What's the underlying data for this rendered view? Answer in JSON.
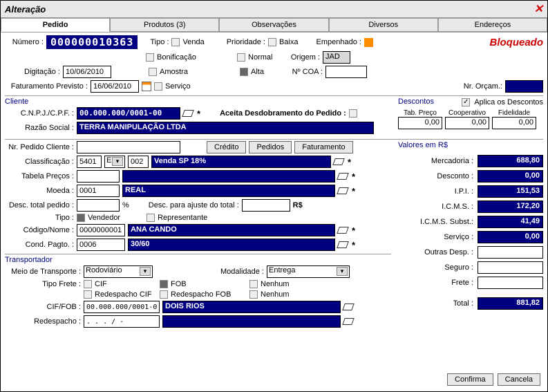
{
  "window": {
    "title": "Alteração",
    "bloqueado": "Bloqueado"
  },
  "tabs": {
    "pedido": "Pedido",
    "produtos": "Produtos (3)",
    "observacoes": "Observações",
    "diversos": "Diversos",
    "enderecos": "Endereços"
  },
  "header": {
    "numero_label": "Número :",
    "numero": "000000010363",
    "tipo_label": "Tipo :",
    "tipo": {
      "venda": "Venda",
      "bonificacao": "Bonificação",
      "amostra": "Amostra",
      "servico": "Serviço"
    },
    "prioridade_label": "Prioridade :",
    "prioridade": {
      "baixa": "Baixa",
      "normal": "Normal",
      "alta": "Alta"
    },
    "empenhado_label": "Empenhado :",
    "origem_label": "Origem :",
    "origem": "JAD",
    "ncoa_label": "Nº COA :",
    "ncoa": "",
    "digitacao_label": "Digitação :",
    "digitacao": "10/06/2010",
    "fatprev_label": "Faturamento Previsto :",
    "fatprev": "16/06/2010",
    "nrorcam_label": "Nr. Orçam.:"
  },
  "cliente": {
    "section": "Cliente",
    "cnpj_label": "C.N.P.J./C.P.F. :",
    "cnpj": "00.000.000/0001-00",
    "aceita_label": "Aceita Desdobramento do Pedido :",
    "razao_label": "Razão Social :",
    "razao": "TERRA   MANIPULAÇÃO LTDA"
  },
  "descontos": {
    "section": "Descontos",
    "aplica": "Aplica os Descontos",
    "tabpreco_h": "Tab. Preço",
    "coop_h": "Cooperativo",
    "fidel_h": "Fidelidade",
    "tabpreco": "0,00",
    "coop": "0,00",
    "fidel": "0,00"
  },
  "pedido": {
    "nrcliente_label": "Nr. Pedido Cliente :",
    "nrcliente": "",
    "btn_credito": "Crédito",
    "btn_pedidos": "Pedidos",
    "btn_fat": "Faturamento",
    "classific_label": "Classificação :",
    "classific1": "5401",
    "classific2": "E",
    "classific3": "002",
    "classific_desc": "Venda SP 18%",
    "tabprecos_label": "Tabela Preços :",
    "tabprecos": "",
    "tabprecos_desc": "",
    "moeda_label": "Moeda :",
    "moeda": "0001",
    "moeda_desc": "REAL",
    "desctotal_label": "Desc. total pedido :",
    "desctotal": "",
    "pct": "%",
    "descajuste_label": "Desc. para ajuste do total :",
    "descajuste": "",
    "rs": "R$",
    "tipo_label": "Tipo :",
    "vendedor": "Vendedor",
    "representante": "Representante",
    "codnome_label": "Código/Nome :",
    "cod": "0000000001",
    "nome": "ANA  CANDO",
    "condpagto_label": "Cond. Pagto. :",
    "condcod": "0006",
    "conddesc": "30/60"
  },
  "valores": {
    "section": "Valores em R$",
    "mercadoria_l": "Mercadoria :",
    "mercadoria": "688,80",
    "desconto_l": "Desconto :",
    "desconto": "0,00",
    "ipi_l": "I.P.I. :",
    "ipi": "151,53",
    "icms_l": "I.C.M.S. :",
    "icms": "172,20",
    "icmssubst_l": "I.C.M.S. Subst.:",
    "icmssubst": "41,49",
    "servico_l": "Serviço :",
    "servico": "0,00",
    "outras_l": "Outras Desp. :",
    "outras": "",
    "seguro_l": "Seguro :",
    "seguro": "",
    "frete_l": "Frete :",
    "frete": "",
    "total_l": "Total :",
    "total": "881,82"
  },
  "transp": {
    "section": "Transportador",
    "meio_label": "Meio de Transporte :",
    "meio": "Rodoviário",
    "modal_label": "Modalidade :",
    "modal": "Entrega",
    "tipofrete_label": "Tipo Frete :",
    "cif": "CIF",
    "fob": "FOB",
    "nenhum": "Nenhum",
    "redcif": "Redespacho CIF",
    "redfob": "Redespacho FOB",
    "ciffob_label": "CIF/FOB :",
    "ciffob_cnpj": "00.000.000/0001-00",
    "ciffob_nome": "DOIS RIOS",
    "redesp_label": "Redespacho :",
    "redesp_cnpj": ". . . / -",
    "redesp_nome": ""
  },
  "buttons": {
    "confirma": "Confirma",
    "cancela": "Cancela"
  }
}
